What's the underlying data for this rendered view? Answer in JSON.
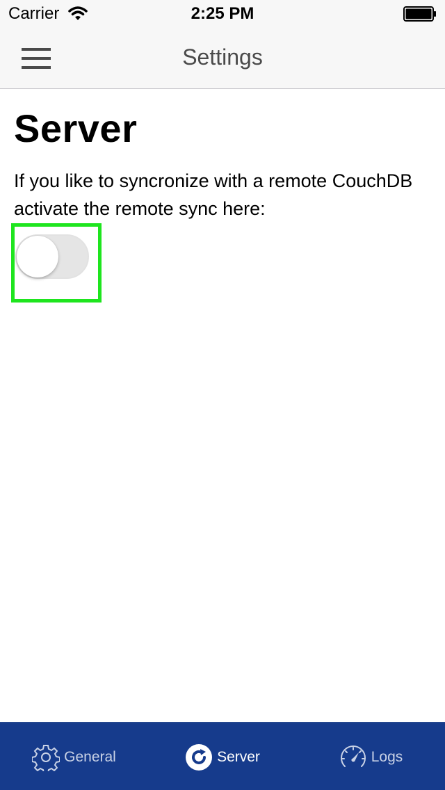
{
  "status_bar": {
    "carrier": "Carrier",
    "time": "2:25 PM",
    "wifi_icon": "wifi-icon",
    "battery_icon": "battery-icon"
  },
  "nav": {
    "title": "Settings",
    "menu_icon": "hamburger-menu-icon"
  },
  "content": {
    "heading": "Server",
    "description": "If you like to syncronize with a remote CouchDB activate the remote sync here:",
    "remote_sync_toggle": {
      "on": false
    }
  },
  "colors": {
    "tab_bar_bg": "#163b8c",
    "highlight": "#1ee51e",
    "toggle_off": "#e5e5e5"
  },
  "tabs": [
    {
      "label": "General",
      "icon": "gear-icon",
      "selected": false
    },
    {
      "label": "Server",
      "icon": "refresh-circle-icon",
      "selected": true
    },
    {
      "label": "Logs",
      "icon": "speedometer-icon",
      "selected": false
    }
  ]
}
